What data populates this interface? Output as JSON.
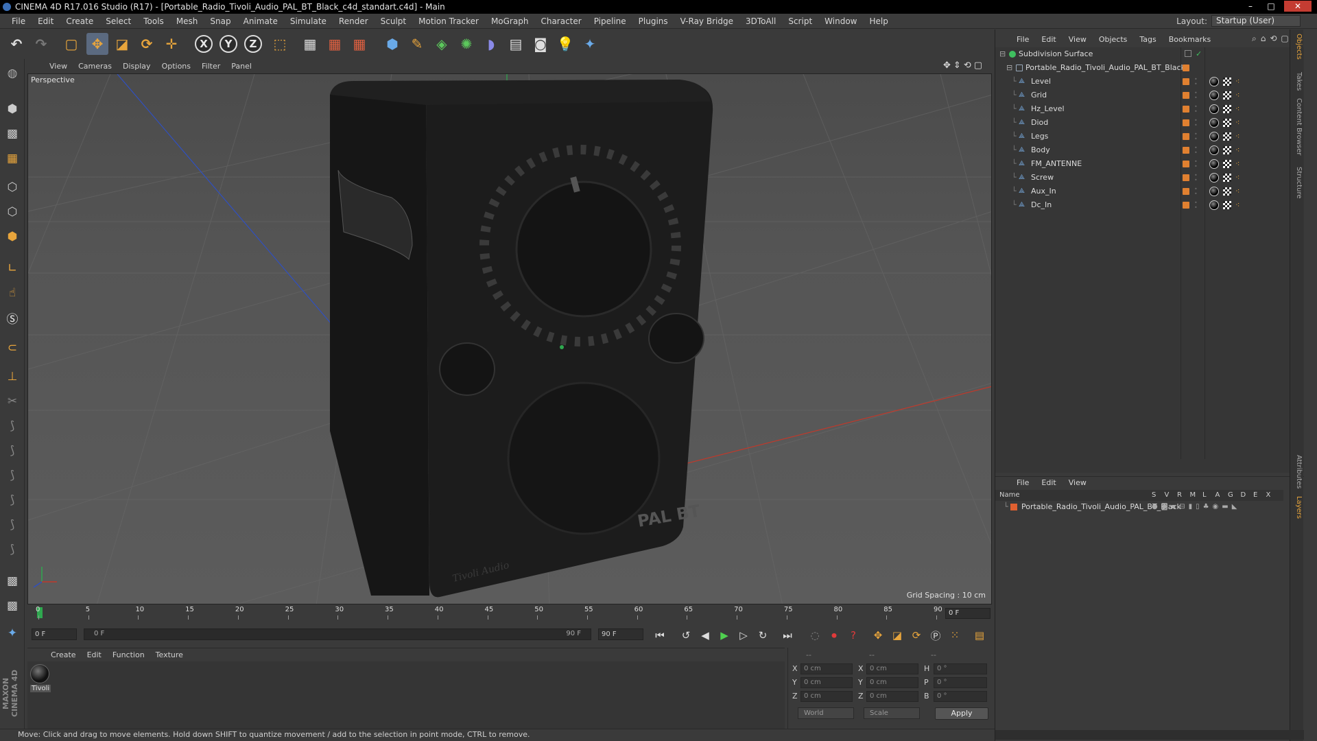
{
  "window": {
    "title": "CINEMA 4D R17.016 Studio (R17) - [Portable_Radio_Tivoli_Audio_PAL_BT_Black_c4d_standart.c4d] - Main",
    "min": "–",
    "max": "□",
    "close": "✕"
  },
  "menu": [
    "File",
    "Edit",
    "Create",
    "Select",
    "Tools",
    "Mesh",
    "Snap",
    "Animate",
    "Simulate",
    "Render",
    "Sculpt",
    "Motion Tracker",
    "MoGraph",
    "Character",
    "Pipeline",
    "Plugins",
    "V-Ray Bridge",
    "3DToAll",
    "Script",
    "Window",
    "Help"
  ],
  "layout": {
    "label": "Layout:",
    "value": "Startup (User)"
  },
  "toolbar": {
    "x": "X",
    "y": "Y",
    "z": "Z"
  },
  "viewport": {
    "menu": [
      "View",
      "Cameras",
      "Display",
      "Options",
      "Filter",
      "Panel"
    ],
    "camera_label": "Perspective",
    "grid_spacing": "Grid Spacing : 10 cm",
    "brand_text": "PAL BT",
    "logo_text": "Tivoli Audio"
  },
  "timeline": {
    "ticks": [
      "0",
      "5",
      "10",
      "15",
      "20",
      "25",
      "30",
      "35",
      "40",
      "45",
      "50",
      "55",
      "60",
      "65",
      "70",
      "75",
      "80",
      "85",
      "90"
    ],
    "current_frame": "0 F",
    "start_field": "0 F",
    "range_start": "0 F",
    "range_end": "90 F",
    "end_field": "90 F"
  },
  "material_manager": {
    "menu": [
      "Create",
      "Edit",
      "Function",
      "Texture"
    ],
    "materials": [
      {
        "name": "Tivoli"
      }
    ]
  },
  "coordinates": {
    "headers": [
      "--",
      "--",
      "--"
    ],
    "rows": [
      {
        "a": "X",
        "av": "0 cm",
        "b": "X",
        "bv": "0 cm",
        "c": "H",
        "cv": "0 °"
      },
      {
        "a": "Y",
        "av": "0 cm",
        "b": "Y",
        "bv": "0 cm",
        "c": "P",
        "cv": "0 °"
      },
      {
        "a": "Z",
        "av": "0 cm",
        "b": "Z",
        "bv": "0 cm",
        "c": "B",
        "cv": "0 °"
      }
    ],
    "space": "World",
    "mode": "Scale",
    "apply": "Apply"
  },
  "status": "Move: Click and drag to move elements. Hold down SHIFT to quantize movement / add to the selection in point mode, CTRL to remove.",
  "object_manager": {
    "menu": [
      "File",
      "Edit",
      "View",
      "Objects",
      "Tags",
      "Bookmarks"
    ],
    "root": "Subdivision Surface",
    "parent": "Portable_Radio_Tivoli_Audio_PAL_BT_Black",
    "children": [
      "Level",
      "Grid",
      "Hz_Level",
      "Diod",
      "Legs",
      "Body",
      "FM_ANTENNE",
      "Screw",
      "Aux_In",
      "Dc_In"
    ]
  },
  "layer_manager": {
    "menu": [
      "File",
      "Edit",
      "View"
    ],
    "columns": {
      "name": "Name",
      "flags": [
        "S",
        "V",
        "R",
        "M",
        "L",
        "A",
        "G",
        "D",
        "E",
        "X"
      ]
    },
    "layers": [
      "Portable_Radio_Tivoli_Audio_PAL_BT_Black"
    ]
  },
  "side_tabs": [
    "Objects",
    "Takes",
    "Content Browser",
    "Structure",
    "Attributes",
    "Layers"
  ],
  "maxon": "MAXON CINEMA 4D",
  "colors": {
    "accent": "#e08030",
    "selection": "#5b6a80",
    "x_axis": "#c0392b",
    "y_axis": "#2fa84f",
    "z_axis": "#3050c0"
  }
}
